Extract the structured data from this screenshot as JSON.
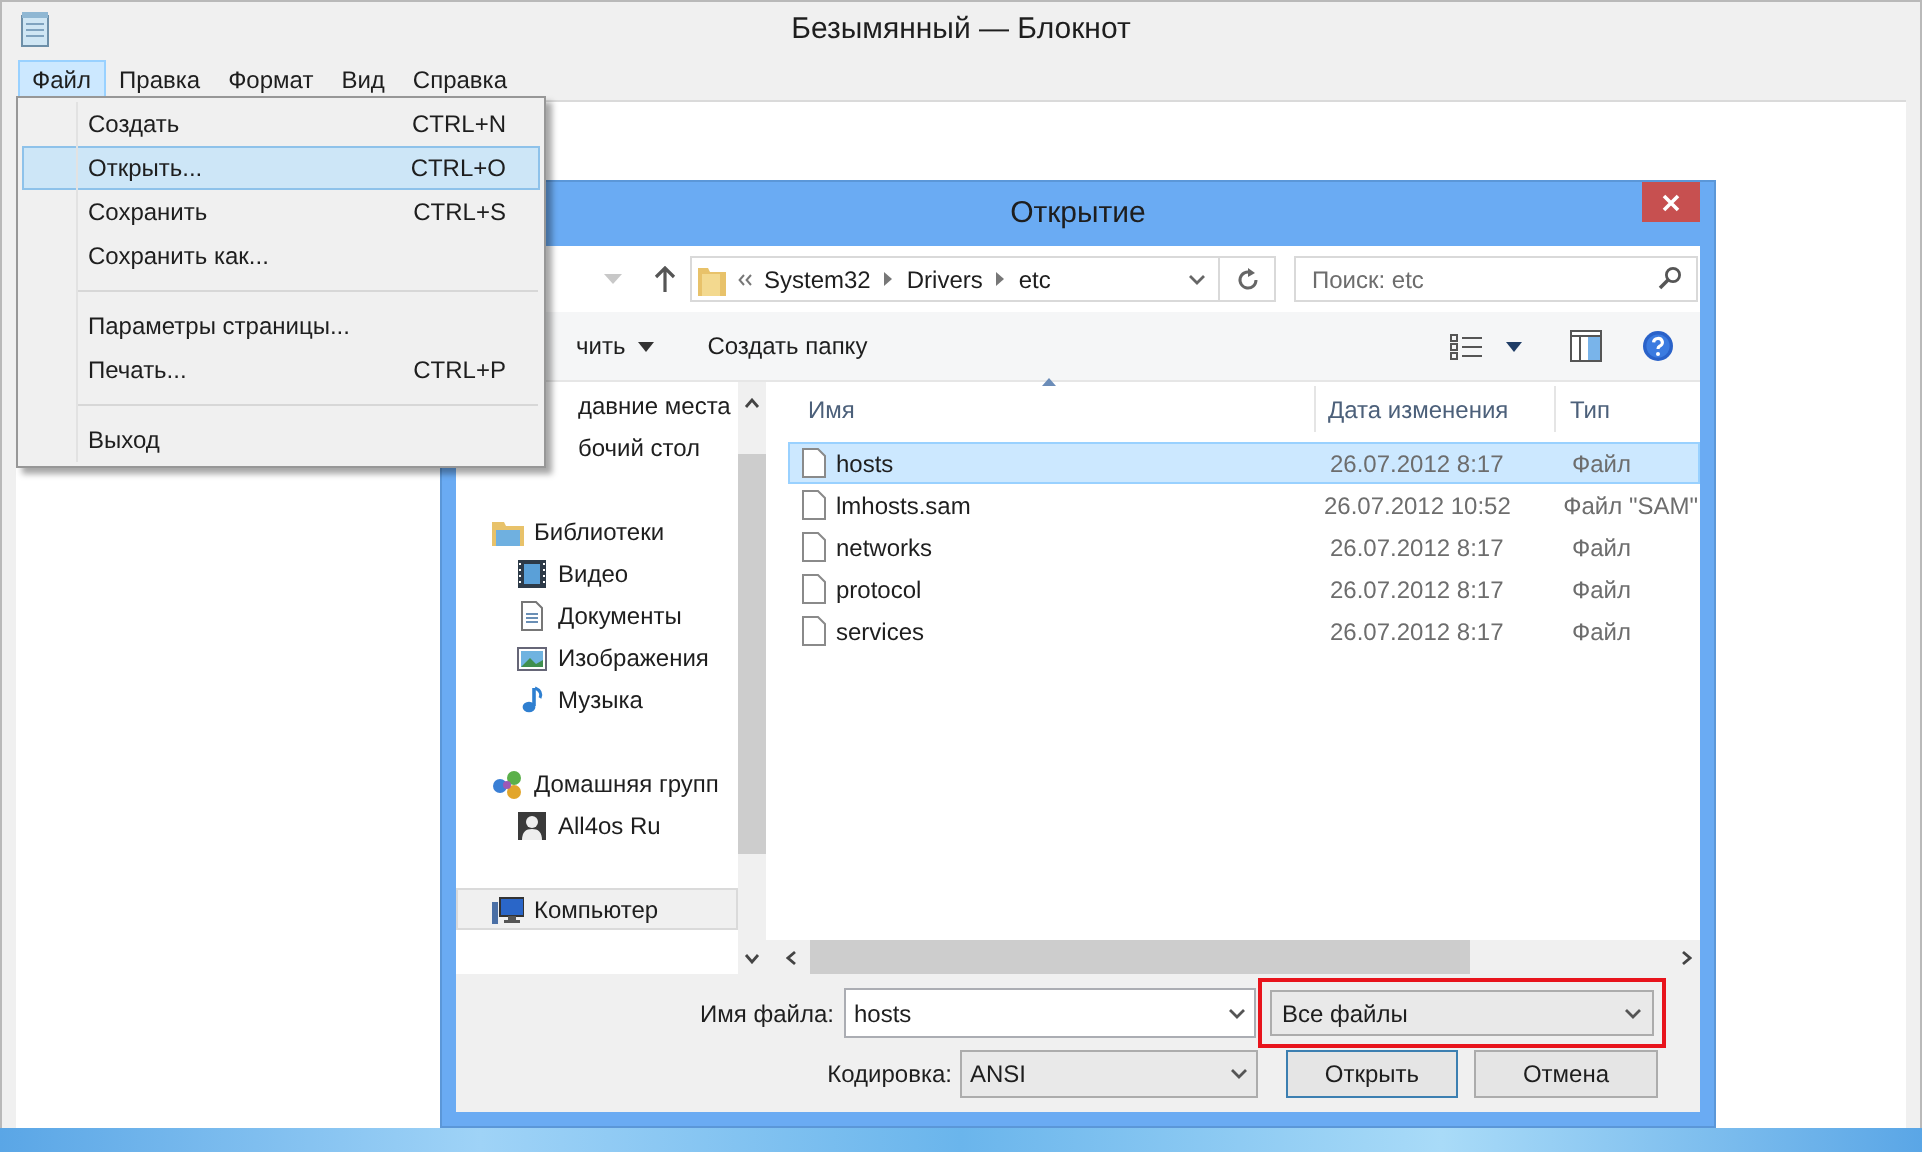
{
  "notepad": {
    "title": "Безымянный — Блокнот",
    "menu_bar": [
      {
        "label": "Файл",
        "selected": true
      },
      {
        "label": "Правка",
        "selected": false
      },
      {
        "label": "Формат",
        "selected": false
      },
      {
        "label": "Вид",
        "selected": false
      },
      {
        "label": "Справка",
        "selected": false
      }
    ],
    "file_menu": {
      "groups": [
        [
          {
            "label": "Создать",
            "shortcut": "CTRL+N",
            "selected": false
          },
          {
            "label": "Открыть...",
            "shortcut": "CTRL+O",
            "selected": true
          },
          {
            "label": "Сохранить",
            "shortcut": "CTRL+S",
            "selected": false
          },
          {
            "label": "Сохранить как...",
            "selected": false
          }
        ],
        [
          {
            "label": "Параметры страницы...",
            "selected": false
          },
          {
            "label": "Печать...",
            "shortcut": "CTRL+P",
            "selected": false
          }
        ],
        [
          {
            "label": "Выход",
            "selected": false
          }
        ]
      ]
    }
  },
  "dialog": {
    "title": "Открытие",
    "address": {
      "path": [
        "System32",
        "Drivers",
        "etc"
      ]
    },
    "search": {
      "placeholder": "Поиск: etc"
    },
    "toolbar": {
      "organize": "чить",
      "new_folder": "Создать папку"
    },
    "nav_pane": {
      "items": [
        {
          "label": "давние места",
          "kind": "cut",
          "selected": false
        },
        {
          "label": "бочий стол",
          "kind": "cut",
          "selected": false
        },
        {
          "label": "Библиотеки",
          "kind": "library",
          "selected": false,
          "children": [
            {
              "label": "Видео",
              "kind": "video",
              "selected": false
            },
            {
              "label": "Документы",
              "kind": "documents",
              "selected": false
            },
            {
              "label": "Изображения",
              "kind": "images",
              "selected": false
            },
            {
              "label": "Музыка",
              "kind": "music",
              "selected": false
            }
          ]
        },
        {
          "label": "Домашняя групп",
          "kind": "homegroup",
          "selected": false,
          "children": [
            {
              "label": "All4os Ru",
              "kind": "user",
              "selected": false
            }
          ]
        },
        {
          "label": "Компьютер",
          "kind": "computer",
          "selected": true
        }
      ]
    },
    "file_list": {
      "columns": [
        "Имя",
        "Дата изменения",
        "Тип"
      ],
      "rows": [
        {
          "name": "hosts",
          "date": "26.07.2012 8:17",
          "type": "Файл",
          "selected": true
        },
        {
          "name": "lmhosts.sam",
          "date": "26.07.2012 10:52",
          "type": "Файл \"SAM\"",
          "selected": false
        },
        {
          "name": "networks",
          "date": "26.07.2012 8:17",
          "type": "Файл",
          "selected": false
        },
        {
          "name": "protocol",
          "date": "26.07.2012 8:17",
          "type": "Файл",
          "selected": false
        },
        {
          "name": "services",
          "date": "26.07.2012 8:17",
          "type": "Файл",
          "selected": false
        }
      ]
    },
    "filename_label": "Имя файла:",
    "filename": "hosts",
    "filter": {
      "value": "Все файлы",
      "highlighted": true
    },
    "encoding_label": "Кодировка:",
    "encoding": "ANSI",
    "buttons": [
      {
        "label": "Открыть",
        "default": true
      },
      {
        "label": "Отмена",
        "default": false
      }
    ]
  }
}
